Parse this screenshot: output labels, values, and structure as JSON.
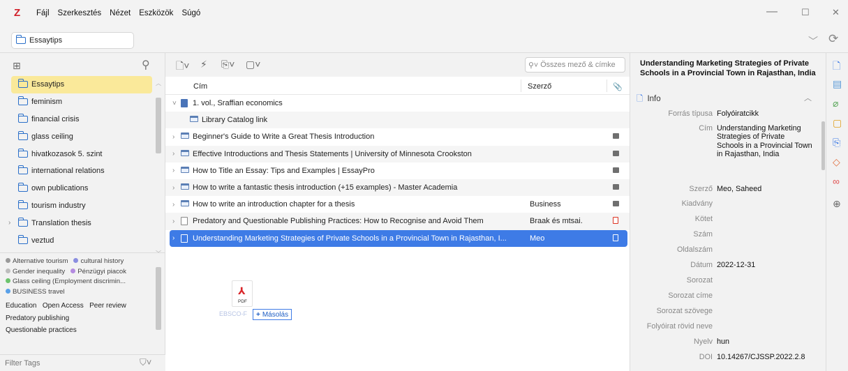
{
  "app": {
    "logo": "Z",
    "menu": [
      "Fájl",
      "Szerkesztés",
      "Nézet",
      "Eszközök",
      "Súgó"
    ],
    "window_controls": {
      "minimize": "—",
      "maximize": "☐",
      "close": "✕"
    }
  },
  "tabbar": {
    "tab_label": "Essaytips"
  },
  "collections": {
    "items": [
      {
        "label": "Essaytips",
        "selected": true,
        "has_children": false
      },
      {
        "label": "feminism"
      },
      {
        "label": "financial crisis"
      },
      {
        "label": "glass ceiling"
      },
      {
        "label": "hivatkozasok 5. szint"
      },
      {
        "label": "international relations"
      },
      {
        "label": "own publications"
      },
      {
        "label": "tourism industry"
      },
      {
        "label": "Translation thesis",
        "has_children": true
      },
      {
        "label": "veztud"
      }
    ]
  },
  "tags": {
    "colored": [
      {
        "label": "Alternative tourism",
        "color": "#9a9a9a"
      },
      {
        "label": "cultural history",
        "color": "#8a8ee0"
      },
      {
        "label": "Gender inequality",
        "color": "#bdbdbd"
      },
      {
        "label": "Pénzügyi piacok",
        "color": "#b48be0"
      },
      {
        "label": "Glass ceiling (Employment discrimin...",
        "color": "#6cc36c"
      },
      {
        "label": "BUSINESS travel",
        "color": "#59a0e8"
      }
    ],
    "plain": [
      "Education",
      "Open Access",
      "Peer review",
      "Predatory publishing",
      "Questionable practices"
    ],
    "filter_placeholder": "Filter Tags"
  },
  "items": {
    "search_placeholder": "Összes mező & címke",
    "columns": {
      "title": "Cím",
      "creator": "Szerző"
    },
    "rows": [
      {
        "title": "1. vol., Sraffian economics",
        "creator": "",
        "type": "book",
        "expanded": true,
        "attachment": ""
      },
      {
        "title": "Library Catalog link",
        "creator": "",
        "type": "link",
        "child": true,
        "attachment": ""
      },
      {
        "title": "Beginner's Guide to Write a Great Thesis Introduction",
        "creator": "",
        "type": "web",
        "attachment": "snapshot"
      },
      {
        "title": "Effective Introductions and Thesis Statements | University of Minnesota Crookston",
        "creator": "",
        "type": "web",
        "attachment": "snapshot"
      },
      {
        "title": "How to Title an Essay: Tips and Examples | EssayPro",
        "creator": "",
        "type": "web",
        "attachment": "snapshot"
      },
      {
        "title": "How to write a fantastic thesis introduction (+15 examples) - Master Academia",
        "creator": "",
        "type": "web",
        "attachment": "snapshot"
      },
      {
        "title": "How to write an introduction chapter for a thesis",
        "creator": "Business",
        "type": "web",
        "attachment": "snapshot"
      },
      {
        "title": "Predatory and Questionable Publishing Practices: How to Recognise and Avoid Them",
        "creator": "Braak és mtsai.",
        "type": "doc",
        "attachment": "pdf"
      },
      {
        "title": "Understanding Marketing Strategies of Private Schools in a Provincial Town in Rajasthan, I...",
        "creator": "Meo",
        "type": "doc",
        "attachment": "doc",
        "selected": true
      }
    ]
  },
  "drag": {
    "file_label": "PDF",
    "file_name": "EBSCO-F",
    "action_label": "Másolás",
    "plus": "+"
  },
  "item_pane": {
    "title": "Understanding Marketing Strategies of Private Schools in a Provincial Town in Rajasthan, India",
    "section_title": "Info",
    "fields": [
      {
        "key": "Forrás típusa",
        "value": "Folyóiratcikk"
      },
      {
        "key": "Cím",
        "value": "Understanding Marketing Strategies of Private Schools in a Provincial Town in Rajasthan, India"
      },
      {
        "key": "Szerző",
        "value": "Meo,  Saheed"
      },
      {
        "key": "Kiadvány",
        "value": ""
      },
      {
        "key": "Kötet",
        "value": ""
      },
      {
        "key": "Szám",
        "value": ""
      },
      {
        "key": "Oldalszám",
        "value": ""
      },
      {
        "key": "Dátum",
        "value": "2022-12-31"
      },
      {
        "key": "Sorozat",
        "value": ""
      },
      {
        "key": "Sorozat címe",
        "value": ""
      },
      {
        "key": "Sorozat szövege",
        "value": ""
      },
      {
        "key": "Folyóirat rövid neve",
        "value": ""
      },
      {
        "key": "Nyelv",
        "value": "hun"
      },
      {
        "key": "DOI",
        "value": "10.14267/CJSSP.2022.2.8"
      }
    ]
  },
  "colors": {
    "accent": "#3e7be6",
    "selected_collection": "#fae99a",
    "logo": "#d1202a"
  }
}
